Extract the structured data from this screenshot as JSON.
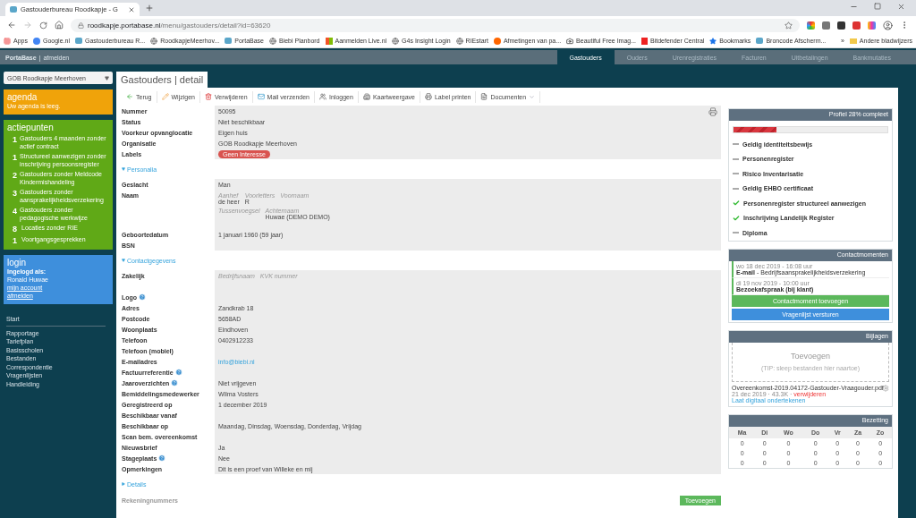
{
  "browser": {
    "tab_title": "Gastouderbureau Roodkapje - G",
    "url_host": "roodkapje.portabase.nl",
    "url_path": "/menu/gastouders/detail?id=63620",
    "bookmarks": [
      {
        "label": "Apps",
        "kind": "apps"
      },
      {
        "label": "Google.nl",
        "kind": "google"
      },
      {
        "label": "Gastouderbureau R...",
        "kind": "site"
      },
      {
        "label": "RoodkapjeMeerhov...",
        "kind": "globe"
      },
      {
        "label": "PortaBase",
        "kind": "site"
      },
      {
        "label": "Biebi Planbord",
        "kind": "globe"
      },
      {
        "label": "Aanmelden Live.nl",
        "kind": "windows"
      },
      {
        "label": "G4s Insight Login",
        "kind": "globe"
      },
      {
        "label": "RIEstart",
        "kind": "globe"
      },
      {
        "label": "Afmetingen van pa...",
        "kind": "orange"
      },
      {
        "label": "Beautiful Free Imag...",
        "kind": "camera"
      },
      {
        "label": "Bitdefender Central",
        "kind": "bitdefender"
      },
      {
        "label": "Bookmarks",
        "kind": "star"
      },
      {
        "label": "Broncode Afscherm...",
        "kind": "site"
      }
    ],
    "more": "»",
    "other_bookmarks": "Andere bladwijzers"
  },
  "topbar": {
    "brand": "PortaBase",
    "separator": "|",
    "logout": "afmelden",
    "nav": [
      {
        "label": "Gastouders",
        "selected": true
      },
      {
        "label": "Ouders",
        "selected": false
      },
      {
        "label": "Urenregistraties",
        "selected": false
      },
      {
        "label": "Facturen",
        "selected": false
      },
      {
        "label": "Uitbetalingen",
        "selected": false
      },
      {
        "label": "Bankmutaties",
        "selected": false
      }
    ]
  },
  "sidebar": {
    "organisation": "GOB Roodkapje Meerhoven",
    "agenda": {
      "title": "agenda",
      "text": "Uw agenda is leeg."
    },
    "actiepunten": {
      "title": "actiepunten",
      "items": [
        {
          "count": "1",
          "label": "Gastouders 4 maanden zonder actief contract"
        },
        {
          "count": "1",
          "label": "Structureel aanwezigen zonder inschrijving persoonsregister"
        },
        {
          "count": "2",
          "label": "Gastouders zonder Meldcode Kindermishandeling"
        },
        {
          "count": "3",
          "label": "Gastouders zonder aansprakelijkheidsverzekering"
        },
        {
          "count": "4",
          "label": "Gastouders zonder pedagogische werkwijze"
        },
        {
          "count": "8",
          "label": "Locaties zonder RIE"
        },
        {
          "count": "1",
          "label": "Voortgangsgesprekken"
        }
      ]
    },
    "login": {
      "title": "login",
      "label": "Ingelogd als:",
      "user": "Ronald Huwae",
      "links": [
        "mijn account",
        "afmelden"
      ]
    },
    "start": "Start",
    "menu": [
      "Rapportage",
      "Tariefplan",
      "Basisscholen",
      "Bestanden",
      "Correspondentie",
      "Vragenlijsten",
      "Handleiding"
    ]
  },
  "page_title": "Gastouders | detail",
  "toolbar": [
    {
      "label": "Terug",
      "kind": "back"
    },
    {
      "label": "Wijzigen",
      "kind": "edit"
    },
    {
      "label": "Verwijderen",
      "kind": "delete"
    },
    {
      "label": "Mail verzenden",
      "kind": "mail"
    },
    {
      "label": "Inloggen",
      "kind": "login"
    },
    {
      "label": "Kaartweergave",
      "kind": "map"
    },
    {
      "label": "Label printen",
      "kind": "print"
    },
    {
      "label": "Documenten",
      "kind": "documents"
    }
  ],
  "general": [
    {
      "label": "Nummer",
      "kind": "text",
      "value": "50095",
      "help": false
    },
    {
      "label": "Status",
      "kind": "text",
      "value": "Niet beschikbaar",
      "help": false
    },
    {
      "label": "Voorkeur opvanglocatie",
      "kind": "text",
      "value": "Eigen huis",
      "help": false
    },
    {
      "label": "Organisatie",
      "kind": "text",
      "value": "GOB Roodkapje Meerhoven",
      "help": false
    },
    {
      "label": "Labels",
      "kind": "tag",
      "value": "Geen Interesse",
      "help": false
    }
  ],
  "sections": [
    {
      "title": "Personalia",
      "expanded": true,
      "rows": [
        {
          "label": "Geslacht",
          "kind": "text",
          "value": "Man",
          "help": false
        },
        {
          "label": "Naam",
          "kind": "fields",
          "help": false,
          "lines": [
            [
              {
                "caption": "Aanhef",
                "value": "de heer"
              },
              {
                "caption": "Voorletters",
                "value": "R"
              },
              {
                "caption": "Voornaam"
              }
            ],
            [
              {
                "caption": "Tussenvoegsel"
              },
              {
                "caption": "Achternaam",
                "value": "Huwae (DEMO DEMO)"
              }
            ]
          ]
        },
        {
          "label": "Geboortedatum",
          "kind": "text",
          "value": "1 januari 1960 (59 jaar)",
          "help": false
        },
        {
          "label": "BSN",
          "kind": "text",
          "help": false
        }
      ]
    },
    {
      "title": "Contactgegevens",
      "expanded": true,
      "rows": [
        {
          "label": "Zakelijk",
          "kind": "fields",
          "help": false,
          "lines": [
            [
              {
                "caption": "Bedrijfsnaam"
              },
              {
                "caption": "KVK nummer"
              }
            ]
          ]
        },
        {
          "label": "Logo",
          "kind": "text",
          "help": true
        },
        {
          "label": "Adres",
          "kind": "text",
          "value": "Zandkrab 18",
          "help": false
        },
        {
          "label": "Postcode",
          "kind": "text",
          "value": "5658AD",
          "help": false
        },
        {
          "label": "Woonplaats",
          "kind": "text",
          "value": "Eindhoven",
          "help": false
        },
        {
          "label": "Telefoon",
          "kind": "text",
          "value": "0402912233",
          "help": false
        },
        {
          "label": "Telefoon (mobiel)",
          "kind": "text",
          "help": false
        },
        {
          "label": "E-mailadres",
          "kind": "link",
          "value": "info@biebi.nl",
          "help": false
        },
        {
          "label": "Factuurreferentie",
          "kind": "text",
          "help": true
        },
        {
          "label": "Jaaroverzichten",
          "kind": "text",
          "value": "Niet vrijgeven",
          "help": true
        },
        {
          "label": "Bemiddelingsmedewerker",
          "kind": "text",
          "value": "Wilma Vosters",
          "help": false
        },
        {
          "label": "Geregistreerd op",
          "kind": "text",
          "value": "1 december 2019",
          "help": false
        },
        {
          "label": "Beschikbaar vanaf",
          "kind": "text",
          "help": false
        },
        {
          "label": "Beschikbaar op",
          "kind": "text",
          "value": "Maandag, Dinsdag, Woensdag, Donderdag, Vrijdag",
          "help": false
        },
        {
          "label": "Scan bem. overeenkomst",
          "kind": "text",
          "help": false
        },
        {
          "label": "Nieuwsbrief",
          "kind": "text",
          "value": "Ja",
          "help": false
        },
        {
          "label": "Stageplaats",
          "kind": "text",
          "value": "Nee",
          "help": true
        },
        {
          "label": "Opmerkingen",
          "kind": "text",
          "value": "Dit is een proef van Willeke en mij",
          "help": false
        }
      ]
    },
    {
      "title": "Details",
      "expanded": false
    }
  ],
  "accounts": {
    "label": "Rekeningnummers",
    "button": "Toevoegen"
  },
  "profile": {
    "title": "Profiel 28% compleet",
    "level": 0.28,
    "items": [
      {
        "label": "Geldig identiteitsbewijs",
        "done": false
      },
      {
        "label": "Personenregister",
        "done": false
      },
      {
        "label": "Risico Inventarisatie",
        "done": false
      },
      {
        "label": "Geldig EHBO certificaat",
        "done": false
      },
      {
        "label": "Personenregister structureel aanwezigen",
        "done": true
      },
      {
        "label": "Inschrijving Landelijk Register",
        "done": true
      },
      {
        "label": "Diploma",
        "done": false
      }
    ]
  },
  "contacts": {
    "title": "Contactmomenten",
    "items": [
      {
        "date": "wo 18 dec 2019 - 16:08 uur",
        "type": "E-mail",
        "subject": " - Bedrijfsaansprakelijkheidsverzekering"
      },
      {
        "date": "di 19 nov 2019 - 10:00 uur",
        "type": "Bezoekafspraak (bij klant)"
      }
    ],
    "add": "Contactmoment toevoegen",
    "survey": "Vragenlijst versturen"
  },
  "attachments": {
    "title": "Bijlagen",
    "drop": "Toevoegen",
    "tip": "(TIP: sleep bestanden hier naartoe)",
    "files": [
      {
        "name": "Overeenkomst-2019.04172-Gastouder-Vraagouder.pdf",
        "meta": "21 dec 2019 · 43.3K ·",
        "delete": "verwijderen",
        "sign": "Laat digitaal ondertekenen"
      }
    ]
  },
  "occupancy": {
    "title": "Bezetting",
    "days": [
      "Ma",
      "Di",
      "Wo",
      "Do",
      "Vr",
      "Za",
      "Zo"
    ],
    "rows": [
      [
        "0",
        "0",
        "0",
        "0",
        "0",
        "0",
        "0"
      ],
      [
        "0",
        "0",
        "0",
        "0",
        "0",
        "0",
        "0"
      ],
      [
        "0",
        "0",
        "0",
        "0",
        "0",
        "0",
        "0"
      ]
    ]
  }
}
